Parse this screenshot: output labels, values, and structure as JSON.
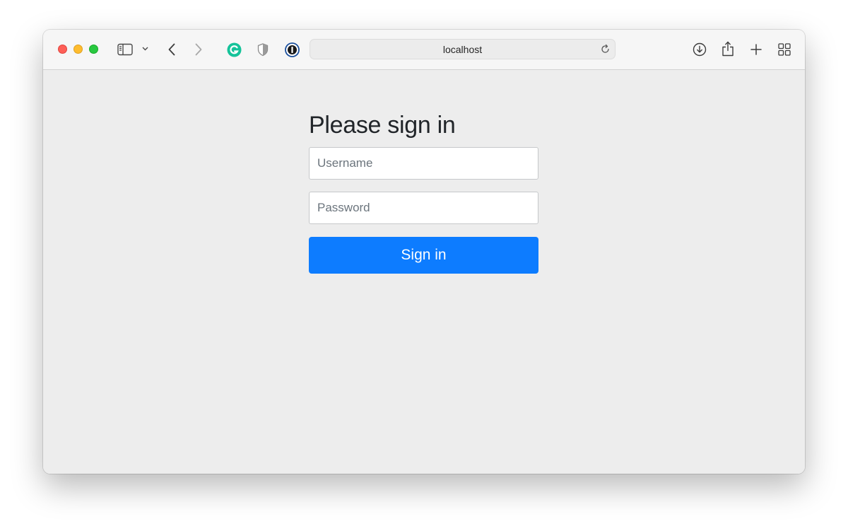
{
  "browser": {
    "address": "localhost",
    "toolbar_icons": [
      "sidebar-icon",
      "chevron-down-icon",
      "back-icon",
      "forward-icon",
      "grammarly-icon",
      "shield-icon",
      "1password-icon",
      "reload-icon",
      "download-icon",
      "share-icon",
      "plus-icon",
      "tab-overview-icon"
    ],
    "traffic_light_colors": {
      "close": "#fe5f57",
      "minimize": "#febc2e",
      "maximize": "#28c840"
    }
  },
  "login": {
    "heading": "Please sign in",
    "username_placeholder": "Username",
    "username_value": "",
    "password_placeholder": "Password",
    "password_value": "",
    "submit_label": "Sign in",
    "accent_color": "#0d7cff"
  }
}
